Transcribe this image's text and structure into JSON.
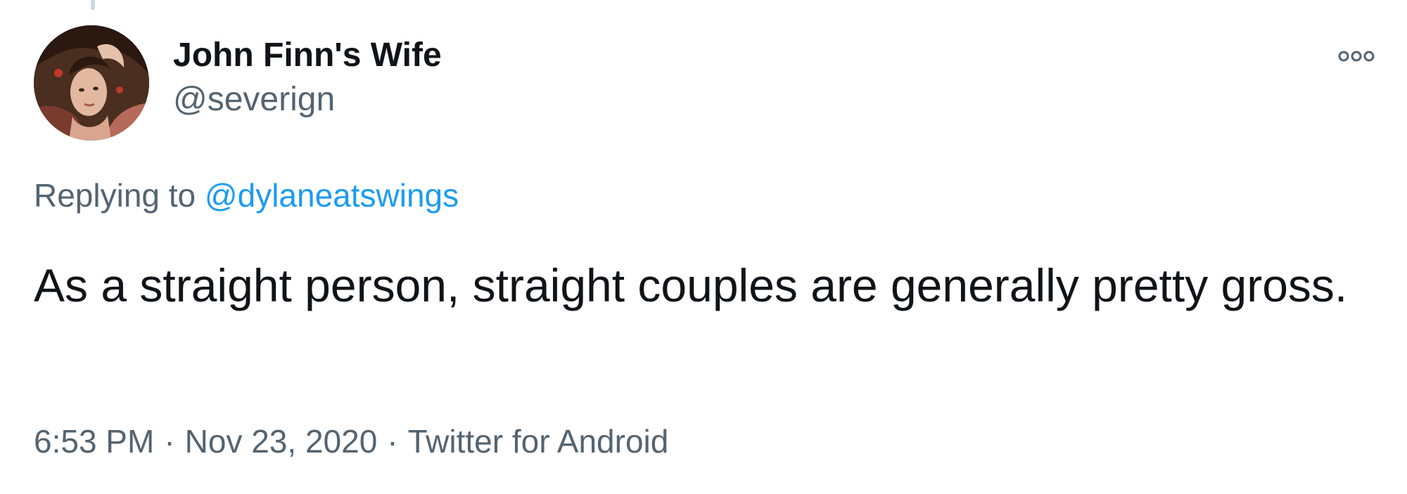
{
  "tweet": {
    "author": {
      "display_name": "John Finn's Wife",
      "handle": "@severign",
      "avatar_icon": "avatar-portrait"
    },
    "more_icon": "more-options-icon",
    "reply": {
      "prefix": "Replying to",
      "target_handle": "@dylaneatswings"
    },
    "text": "As a straight person, straight couples are generally pretty gross.",
    "time": "6:53 PM",
    "separator": "·",
    "date": "Nov 23, 2020",
    "source": "Twitter for Android"
  },
  "colors": {
    "text_primary": "#0f1419",
    "text_secondary": "#536471",
    "link": "#1d9bf0",
    "background": "#ffffff"
  }
}
